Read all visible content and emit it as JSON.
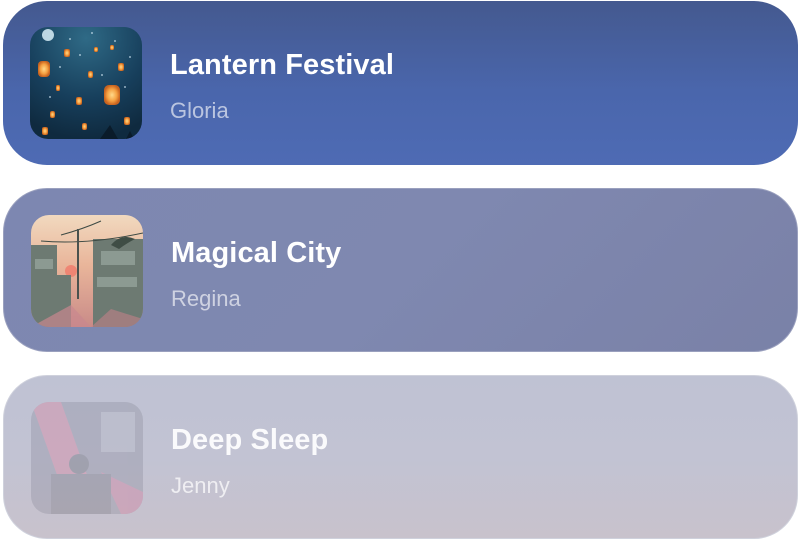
{
  "playlist": {
    "items": [
      {
        "title": "Lantern Festival",
        "artist": "Gloria",
        "artwork": "lantern-festival-artwork"
      },
      {
        "title": "Magical City",
        "artist": "Regina",
        "artwork": "magical-city-artwork"
      },
      {
        "title": "Deep Sleep",
        "artist": "Jenny",
        "artwork": "deep-sleep-artwork"
      }
    ]
  }
}
